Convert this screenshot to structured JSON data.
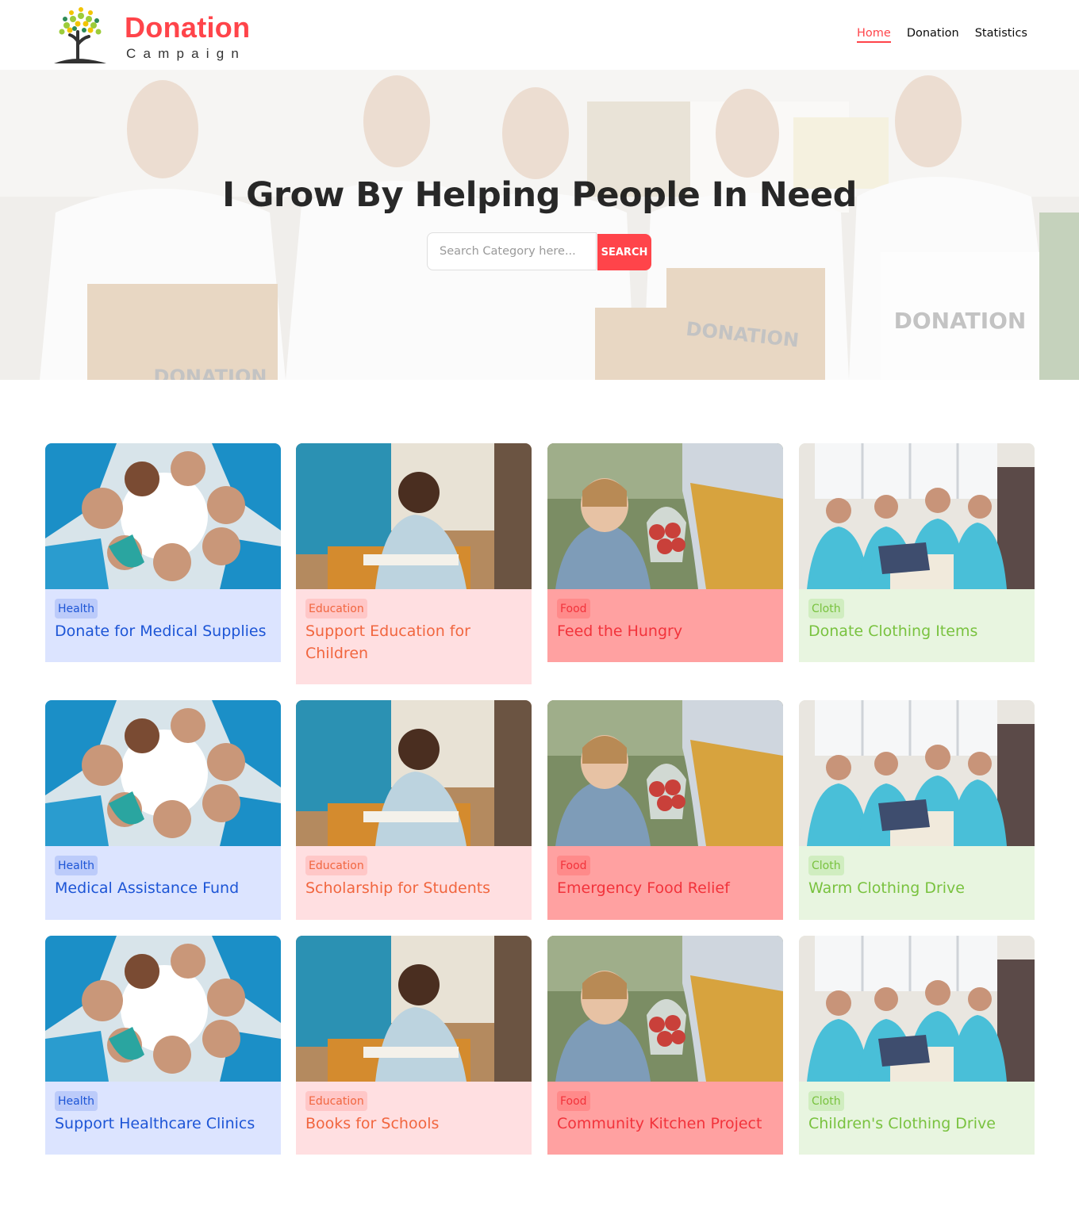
{
  "brand": {
    "title": "Donation",
    "subtitle": "Campaign"
  },
  "nav": [
    {
      "label": "Home",
      "active": true
    },
    {
      "label": "Donation",
      "active": false
    },
    {
      "label": "Statistics",
      "active": false
    }
  ],
  "hero": {
    "title": "I Grow By Helping People In Need",
    "search_placeholder": "Search Category here...",
    "search_button": "SEARCH"
  },
  "colors": {
    "accent": "#ff444a"
  },
  "categories": {
    "Health": {
      "card_bg": "#dce4ff",
      "tag_bg": "#bccbfa",
      "text": "#1d55d6",
      "image": "people-circle"
    },
    "Education": {
      "card_bg": "#ffdfe1",
      "tag_bg": "#ffc7c7",
      "text": "#f1663f",
      "image": "student-classroom"
    },
    "Food": {
      "card_bg": "#ffa1a1",
      "tag_bg": "#ff8a8a",
      "text": "#f2333b",
      "image": "girl-food-bag"
    },
    "Cloth": {
      "card_bg": "#e8f5e0",
      "tag_bg": "#d0edc0",
      "text": "#79c23f",
      "image": "volunteers-clothes"
    }
  },
  "cards": [
    {
      "category": "Health",
      "title": "Donate for Medical Supplies"
    },
    {
      "category": "Education",
      "title": "Support Education for Children"
    },
    {
      "category": "Food",
      "title": "Feed the Hungry"
    },
    {
      "category": "Cloth",
      "title": "Donate Clothing Items"
    },
    {
      "category": "Health",
      "title": "Medical Assistance Fund"
    },
    {
      "category": "Education",
      "title": "Scholarship for Students"
    },
    {
      "category": "Food",
      "title": "Emergency Food Relief"
    },
    {
      "category": "Cloth",
      "title": "Warm Clothing Drive"
    },
    {
      "category": "Health",
      "title": "Support Healthcare Clinics"
    },
    {
      "category": "Education",
      "title": "Books for Schools"
    },
    {
      "category": "Food",
      "title": "Community Kitchen Project"
    },
    {
      "category": "Cloth",
      "title": "Children's Clothing Drive"
    }
  ]
}
